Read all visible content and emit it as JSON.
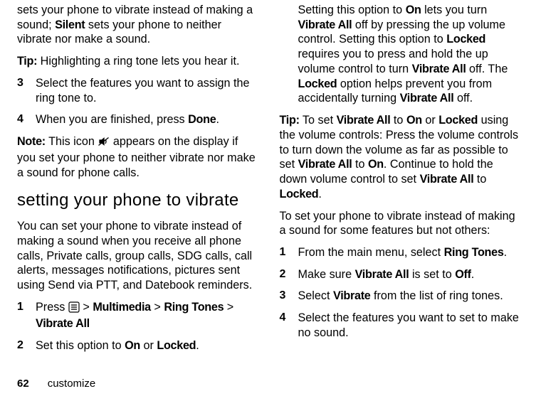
{
  "footer": {
    "page_number": "62",
    "section": "customize"
  },
  "left": {
    "p1_a": "sets your phone to vibrate instead of making a sound; ",
    "p1_silent": "Silent",
    "p1_b": " sets your phone to neither vibrate nor make a sound.",
    "tip1_label": "Tip:",
    "tip1_text": " Highlighting a ring tone lets you hear it.",
    "step3_num": "3",
    "step3_text": "Select the features you want to assign the ring tone to.",
    "step4_num": "4",
    "step4_a": "When you are finished, press ",
    "step4_done": "Done",
    "step4_b": ".",
    "note_label": "Note:",
    "note_a": " This icon ",
    "note_b": " appears on the display if you set your phone to neither vibrate nor make a sound for phone calls.",
    "h2": "setting your phone to vibrate",
    "p2": "You can set your phone to vibrate instead of making a sound when you receive all phone calls, Private calls, group calls, SDG calls, call alerts, messages notifications, pictures sent using Send via PTT, and Datebook reminders.",
    "s1_num": "1",
    "s1_a": "Press ",
    "s1_b": " > ",
    "s1_mm": "Multimedia",
    "s1_c": " > ",
    "s1_rt": "Ring Tones",
    "s1_d": " > ",
    "s1_va": "Vibrate All",
    "s2_num": "2",
    "s2_a": "Set this option to ",
    "s2_on": "On",
    "s2_b": " or ",
    "s2_locked": "Locked",
    "s2_c": "."
  },
  "right": {
    "p1_a": "Setting this option to ",
    "p1_on": "On",
    "p1_b": " lets you turn ",
    "p1_va1": "Vibrate All",
    "p1_c": " off by pressing the up volume control. Setting this option to ",
    "p1_locked": "Locked",
    "p1_d": " requires you to press and hold the up volume control to turn ",
    "p1_va2": "Vibrate All",
    "p1_e": " off. The ",
    "p1_locked2": "Locked",
    "p1_f": " option helps prevent you from accidentally turning ",
    "p1_va3": "Vibrate All",
    "p1_g": " off.",
    "tip_label": "Tip:",
    "tip_a": " To set ",
    "tip_va1": "Vibrate All",
    "tip_b": " to ",
    "tip_on1": "On",
    "tip_c": " or ",
    "tip_locked1": "Locked",
    "tip_d": " using the volume controls: Press the volume controls to turn down the volume as far as possible to set ",
    "tip_va2": "Vibrate All",
    "tip_e": " to ",
    "tip_on2": "On",
    "tip_f": ". Continue to hold the down volume control to set ",
    "tip_va3": "Vibrate All",
    "tip_g": " to ",
    "tip_locked2": "Locked",
    "tip_h": ".",
    "p3": "To set your phone to vibrate instead of making a sound for some features but not others:",
    "r1_num": "1",
    "r1_a": "From the main menu, select ",
    "r1_rt": "Ring Tones",
    "r1_b": ".",
    "r2_num": "2",
    "r2_a": "Make sure ",
    "r2_va": "Vibrate All",
    "r2_b": " is set to ",
    "r2_off": "Off",
    "r2_c": ".",
    "r3_num": "3",
    "r3_a": "Select ",
    "r3_vib": "Vibrate",
    "r3_b": " from the list of ring tones.",
    "r4_num": "4",
    "r4_text": "Select the features you want to set to make no sound."
  }
}
